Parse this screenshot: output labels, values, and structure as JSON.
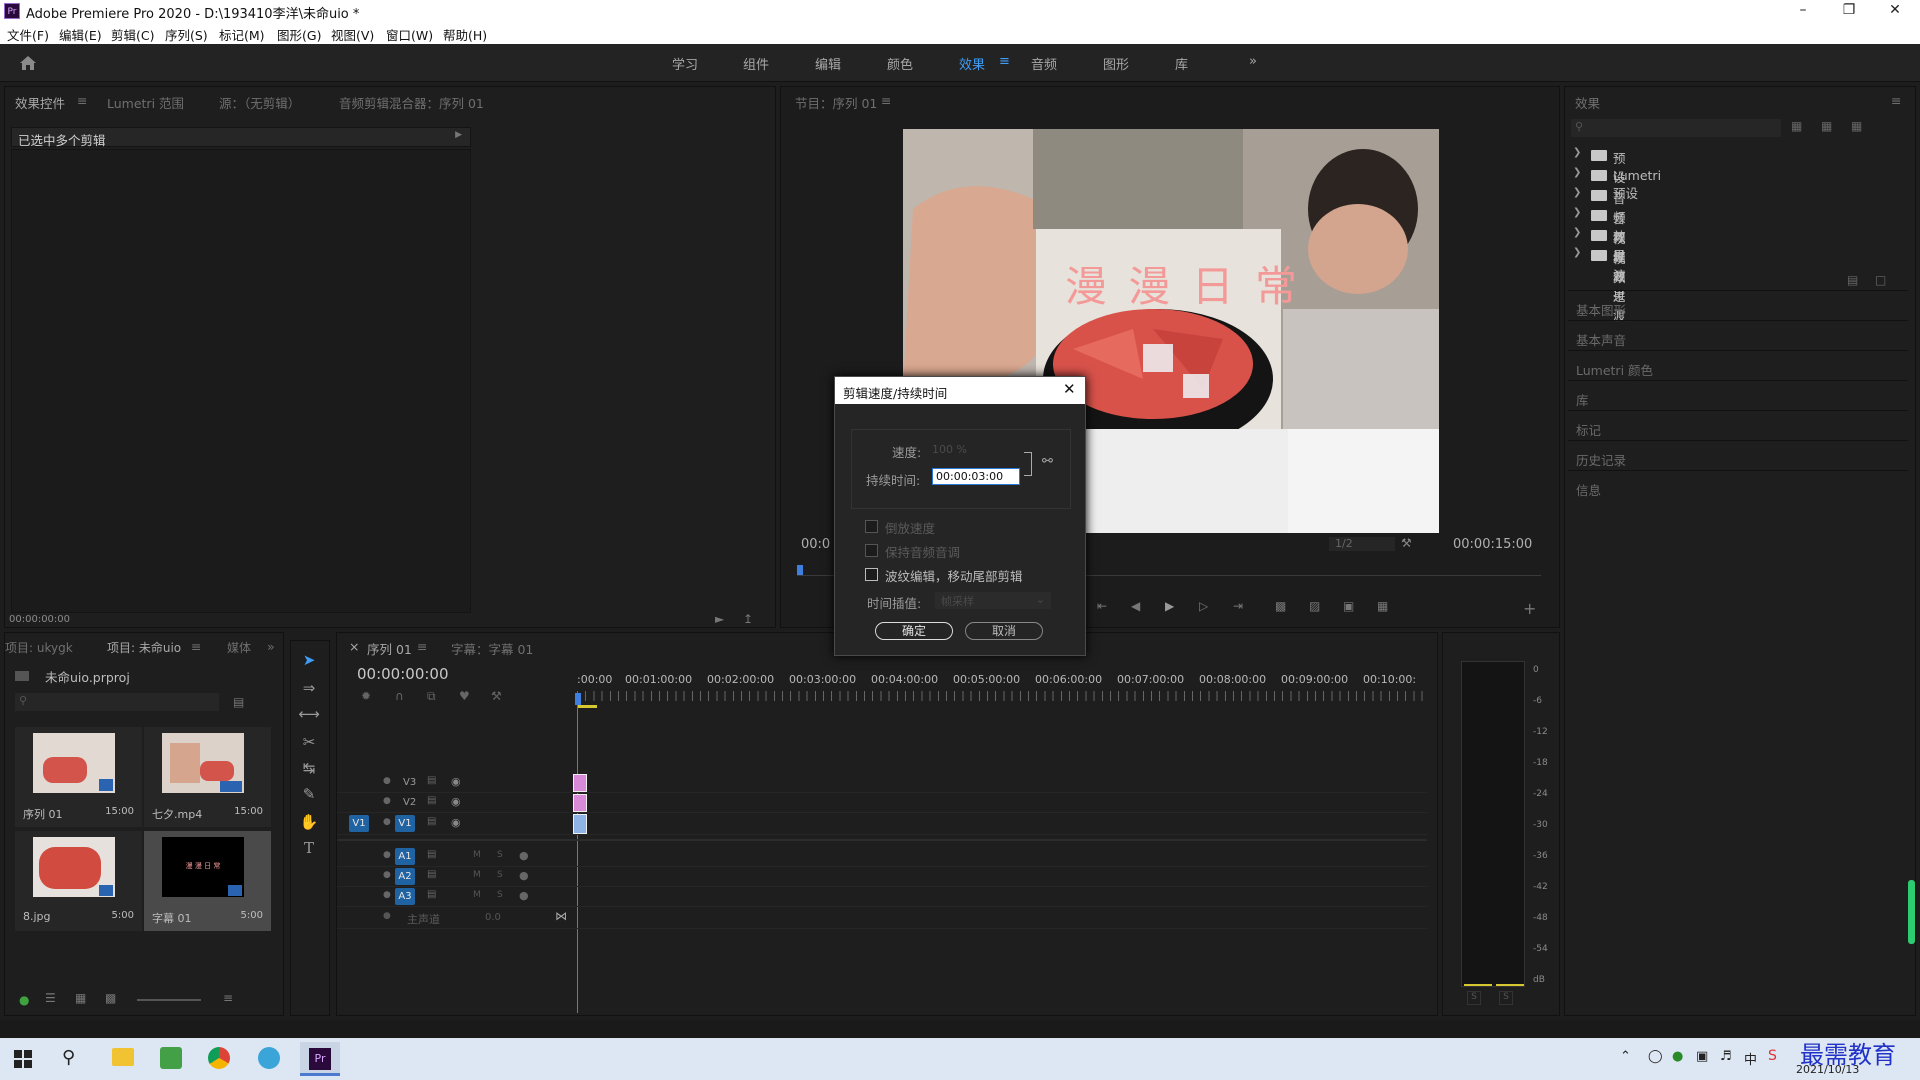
{
  "window": {
    "title": "Adobe Premiere Pro 2020 - D:\\193410李洋\\未命uio *",
    "app_icon": "Pr"
  },
  "menu": [
    "文件(F)",
    "编辑(E)",
    "剪辑(C)",
    "序列(S)",
    "标记(M)",
    "图形(G)",
    "视图(V)",
    "窗口(W)",
    "帮助(H)"
  ],
  "workspaces": [
    "学习",
    "组件",
    "编辑",
    "颜色",
    "效果",
    "音频",
    "图形",
    "库"
  ],
  "active_workspace": "效果",
  "source_panel": {
    "tabs": [
      "效果控件",
      "Lumetri 范围",
      "源：（无剪辑）",
      "音频剪辑混合器：序列 01"
    ],
    "message": "已选中多个剪辑",
    "timecode": "00:00:00:00"
  },
  "program_monitor": {
    "tab": "节目：序列 01",
    "overlay_text": "漫 漫 日 常",
    "timecode_left": "00:0",
    "timecode_right": "00:00:15:00",
    "zoom": "1/2"
  },
  "effects_panel": {
    "title": "效果",
    "items": [
      "预设",
      "Lumetri 预设",
      "音频效果",
      "音频过渡",
      "视频效果",
      "视频过渡"
    ],
    "sections": [
      "基本图形",
      "基本声音",
      "Lumetri 颜色",
      "库",
      "标记",
      "历史记录",
      "信息"
    ]
  },
  "dialog": {
    "title": "剪辑速度/持续时间",
    "speed_label": "速度:",
    "speed_value": "100 %",
    "duration_label": "持续时间:",
    "duration_value": "00:00:03:00",
    "checkboxes": [
      "倒放速度",
      "保持音频音调",
      "波纹编辑，移动尾部剪辑"
    ],
    "interp_label": "时间插值:",
    "interp_value": "帧采样",
    "ok": "确定",
    "cancel": "取消"
  },
  "project_panel": {
    "tabs": [
      "项目: ukygk",
      "项目: 未命uio",
      "媒体"
    ],
    "file": "未命uio.prproj",
    "search_placeholder": "",
    "items": [
      {
        "name": "序列 01",
        "duration": "15:00"
      },
      {
        "name": "七夕.mp4",
        "duration": "15:00"
      },
      {
        "name": "8.jpg",
        "duration": "5:00"
      },
      {
        "name": "字幕 01",
        "duration": "5:00",
        "thumb_text": "漫 漫 日 常"
      }
    ]
  },
  "timeline": {
    "tabs": [
      "序列 01",
      "字幕：字幕 01"
    ],
    "timecode": "00:00:00:00",
    "ruler": [
      ":00:00",
      "00:01:00:00",
      "00:02:00:00",
      "00:03:00:00",
      "00:04:00:00",
      "00:05:00:00",
      "00:06:00:00",
      "00:07:00:00",
      "00:08:00:00",
      "00:09:00:00",
      "00:10:00:"
    ],
    "video_tracks": [
      "V3",
      "V2",
      "V1"
    ],
    "audio_tracks": [
      "A1",
      "A2",
      "A3"
    ],
    "master": "主声道",
    "master_value": "0.0",
    "source_patch": "V1"
  },
  "audio_meter": {
    "scale": [
      "0",
      "-6",
      "-12",
      "-18",
      "-24",
      "-30",
      "-36",
      "-42",
      "-48",
      "-54",
      "dB"
    ],
    "solo": [
      "S",
      "S"
    ]
  },
  "taskbar": {
    "time": "",
    "date": "2021/10/13",
    "ime": "中",
    "watermark": "最需教育"
  },
  "colors": {
    "accent": "#3f9df6",
    "clip_pink": "#d88ad8",
    "clip_blue": "#8fb3e6"
  }
}
